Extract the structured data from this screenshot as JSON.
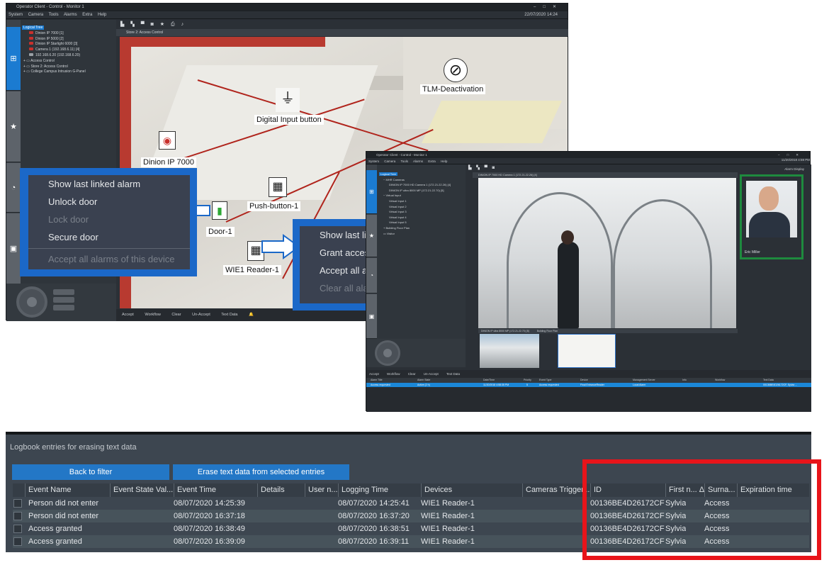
{
  "window1": {
    "title": "Operator Client - Control - Monitor 1",
    "menu": [
      "System",
      "Camera",
      "Tools",
      "Alarms",
      "Extra",
      "Help"
    ],
    "datetime": "22/07/2020 14:24",
    "pane_title": "Store 2: Access Control",
    "tree": [
      "Logical Tree",
      "Dinion IP 7000 [1]",
      "Dinion IP 5000 [2]",
      "Dinion IP Starlight 6000 [3]",
      "Camera 1 (192.168.6.11) [4]",
      "192.168.6.20 (192.168.6.20)",
      "Access Control",
      "Store 2: Access Control",
      "College Campus Intrusion G-Panel"
    ],
    "map_labels": {
      "tlm": "TLM-Deactivation",
      "digital_input": "Digital Input button",
      "dinion": "Dinion IP 7000",
      "push_button": "Push-button-1",
      "door": "Door-1",
      "reader": "WIE1 Reader-1"
    },
    "bottom_bar": [
      "Accept",
      "Workflow",
      "Clear",
      "Un-Accept",
      "Text Data"
    ]
  },
  "context_menu_1": {
    "items": [
      "Show last linked alarm",
      "Unlock door",
      "Lock door",
      "Secure door",
      "Accept all alarms of this device"
    ]
  },
  "context_menu_2": {
    "items": [
      "Show last lin",
      "Grant access",
      "Accept all al",
      "Clear all alar"
    ]
  },
  "window2": {
    "title": "Operator Client - Control - Monitor 1",
    "menu": [
      "System",
      "Camera",
      "Tools",
      "Alarms",
      "Extra",
      "Help"
    ],
    "datetime": "11/20/2018 4:59 PM",
    "pane_title": "DINION IP 7000 HD Camera 1 (172.21.22.26) [4]",
    "alarm_display": "Alarm Display",
    "person_name": "Eric Miller",
    "tree": [
      "Logical Tree",
      "MHR Cameras",
      "DINION IP 7000 HD Camera 1 (172.21.22.26) [4]",
      "DINION IP ultra 8000 MP (172.21.22.70) [5]",
      "Virtual Input",
      "Virtual Input 1",
      "Virtual Input 2",
      "Virtual Input 3",
      "Virtual Input 4",
      "Virtual Input 5",
      "Building Floor Plan",
      "Visitor"
    ],
    "thumb_titles": [
      "DINION IP ultra 8000 MP (172.21.22.70) [5]",
      "Building Floor Plan"
    ],
    "bottom_bar": [
      "Accept",
      "Workflow",
      "Clear",
      "Un-Accept",
      "Text Data"
    ],
    "alarm_columns": [
      "Alarm Title",
      "Alarm State",
      "Date/Time",
      "Priority",
      "Event Type",
      "Device",
      "Management Server",
      "Info",
      "Workflow",
      "Text Data"
    ],
    "alarm_row": [
      "Access requested",
      "Active (2 h)",
      "11/20/2018 4:58:35 PM",
      "5",
      "Access requested",
      "Final EntranceReader",
      "Local Alarm",
      "00136BE4D26172CF, Sylvia ..."
    ]
  },
  "logbook": {
    "title": "Logbook entries for erasing text data",
    "back_button": "Back to filter",
    "erase_button": "Erase text data from selected entries",
    "columns": [
      "Event Name",
      "Event State Val...",
      "Event Time",
      "Details",
      "User n...",
      "Logging Time",
      "Devices",
      "Cameras Trigger...",
      "ID",
      "First n...",
      "Surna...",
      "Expiration time"
    ],
    "sort_indicator": "Δ",
    "rows": [
      {
        "event": "Person did not enter",
        "event_time": "08/07/2020 14:25:39",
        "logging_time": "08/07/2020 14:25:41",
        "device": "WIE1 Reader-1",
        "id": "00136BE4D26172CF",
        "first": "Sylvia",
        "surname": "Access"
      },
      {
        "event": "Person did not enter",
        "event_time": "08/07/2020 16:37:18",
        "logging_time": "08/07/2020 16:37:20",
        "device": "WIE1 Reader-1",
        "id": "00136BE4D26172CF",
        "first": "Sylvia",
        "surname": "Access"
      },
      {
        "event": "Access granted",
        "event_time": "08/07/2020 16:38:49",
        "logging_time": "08/07/2020 16:38:51",
        "device": "WIE1 Reader-1",
        "id": "00136BE4D26172CF",
        "first": "Sylvia",
        "surname": "Access"
      },
      {
        "event": "Access granted",
        "event_time": "08/07/2020 16:39:09",
        "logging_time": "08/07/2020 16:39:11",
        "device": "WIE1 Reader-1",
        "id": "00136BE4D26172CF",
        "first": "Sylvia",
        "surname": "Access"
      }
    ]
  },
  "colors": {
    "highlight_box": "#e8141a",
    "accent_blue": "#2377c6",
    "menu_border": "#1b68c8",
    "photo_frame": "#1e8a3e"
  }
}
